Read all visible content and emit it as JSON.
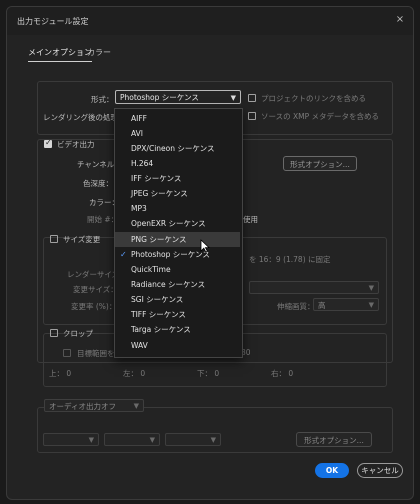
{
  "window": {
    "title": "出力モジュール設定",
    "close_icon": "×"
  },
  "tabs": [
    {
      "label": "メインオプション",
      "active": true
    },
    {
      "label": "カラー",
      "active": false
    }
  ],
  "format": {
    "label": "形式：",
    "selected": "Photoshop シーケンス",
    "include_project_link": "プロジェクトのリンクを含める"
  },
  "post_render": {
    "label": "レンダリング後の処理：",
    "include_xmp": "ソースの XMP メタデータを含める"
  },
  "video_output": {
    "label": "ビデオ出力",
    "channel_label": "チャンネル：",
    "depth_label": "色深度：",
    "color_label": "カラー：",
    "start_label": "開始 #：",
    "use_partial": "使用",
    "format_options_button": "形式オプション..."
  },
  "resize": {
    "label": "サイズ変更",
    "render_size": "レンダーサイズ：",
    "resize_to": "変更サイズ：",
    "resize_pct": "変更率 (%)：",
    "lock_ratio": "を 16：9 (1.78) に固定",
    "quality_label": "伸縮画質：",
    "quality_value": "高"
  },
  "crop": {
    "label": "クロップ",
    "roi_label": "目標範囲を",
    "size_value": "80",
    "top": "上： 0",
    "left": "左： 0",
    "bottom": "下： 0",
    "right": "右： 0"
  },
  "audio": {
    "select_value": "オーディオ出力オフ",
    "format_options_button": "形式オプション..."
  },
  "dropdown": {
    "items": [
      {
        "label": "AIFF",
        "checked": false,
        "hover": false
      },
      {
        "label": "AVI",
        "checked": false,
        "hover": false
      },
      {
        "label": "DPX/Cineon シーケンス",
        "checked": false,
        "hover": false
      },
      {
        "label": "H.264",
        "checked": false,
        "hover": false
      },
      {
        "label": "IFF シーケンス",
        "checked": false,
        "hover": false
      },
      {
        "label": "JPEG シーケンス",
        "checked": false,
        "hover": false
      },
      {
        "label": "MP3",
        "checked": false,
        "hover": false
      },
      {
        "label": "OpenEXR シーケンス",
        "checked": false,
        "hover": false
      },
      {
        "label": "PNG シーケンス",
        "checked": false,
        "hover": true
      },
      {
        "label": "Photoshop シーケンス",
        "checked": true,
        "hover": false
      },
      {
        "label": "QuickTime",
        "checked": false,
        "hover": false
      },
      {
        "label": "Radiance シーケンス",
        "checked": false,
        "hover": false
      },
      {
        "label": "SGI シーケンス",
        "checked": false,
        "hover": false
      },
      {
        "label": "TIFF シーケンス",
        "checked": false,
        "hover": false
      },
      {
        "label": "Targa シーケンス",
        "checked": false,
        "hover": false
      },
      {
        "label": "WAV",
        "checked": false,
        "hover": false
      }
    ]
  },
  "buttons": {
    "ok": "OK",
    "cancel": "キャンセル"
  },
  "colors": {
    "accent": "#1473e6",
    "background": "#232323"
  }
}
